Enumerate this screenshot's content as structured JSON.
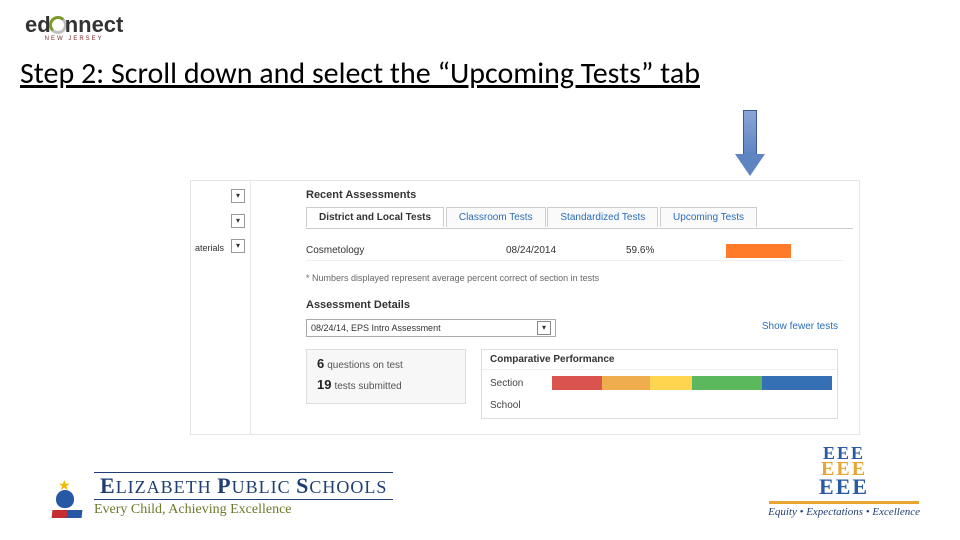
{
  "header": {
    "logo_prefix": "ed",
    "logo_suffix": "nnect",
    "logo_sub": "NEW JERSEY"
  },
  "step_title": "Step 2: Scroll down and select the “Upcoming Tests” tab",
  "screenshot": {
    "sidebar_label": "aterials",
    "recent_assessments_title": "Recent Assessments",
    "tabs": {
      "active": "District and Local Tests",
      "classroom": "Classroom Tests",
      "standardized": "Standardized Tests",
      "upcoming": "Upcoming Tests"
    },
    "row": {
      "name": "Cosmetology",
      "date": "08/24/2014",
      "percent": "59.6%"
    },
    "footnote": "* Numbers displayed represent average percent correct of section in tests",
    "assessment_details_title": "Assessment Details",
    "dropdown_value": "08/24/14, EPS Intro Assessment",
    "show_fewer": "Show fewer tests",
    "stats": {
      "q_count": "6",
      "q_label": "questions on test",
      "t_count": "19",
      "t_label": "tests submitted"
    },
    "comparative": {
      "title": "Comparative Performance",
      "row1": "Section",
      "row2": "School"
    }
  },
  "footer": {
    "eps_name_cap": "E",
    "eps_name_rest1": "LIZABETH ",
    "eps_name_cap2": "P",
    "eps_name_rest2": "UBLIC ",
    "eps_name_cap3": "S",
    "eps_name_rest3": "CHOOLS",
    "eps_tagline": "Every Child, Achieving Excellence",
    "eee_l1": "EEE",
    "eee_l2": "EEE",
    "eee_l3": "EEE",
    "eee_tag": "Equity • Expectations • Excellence"
  }
}
